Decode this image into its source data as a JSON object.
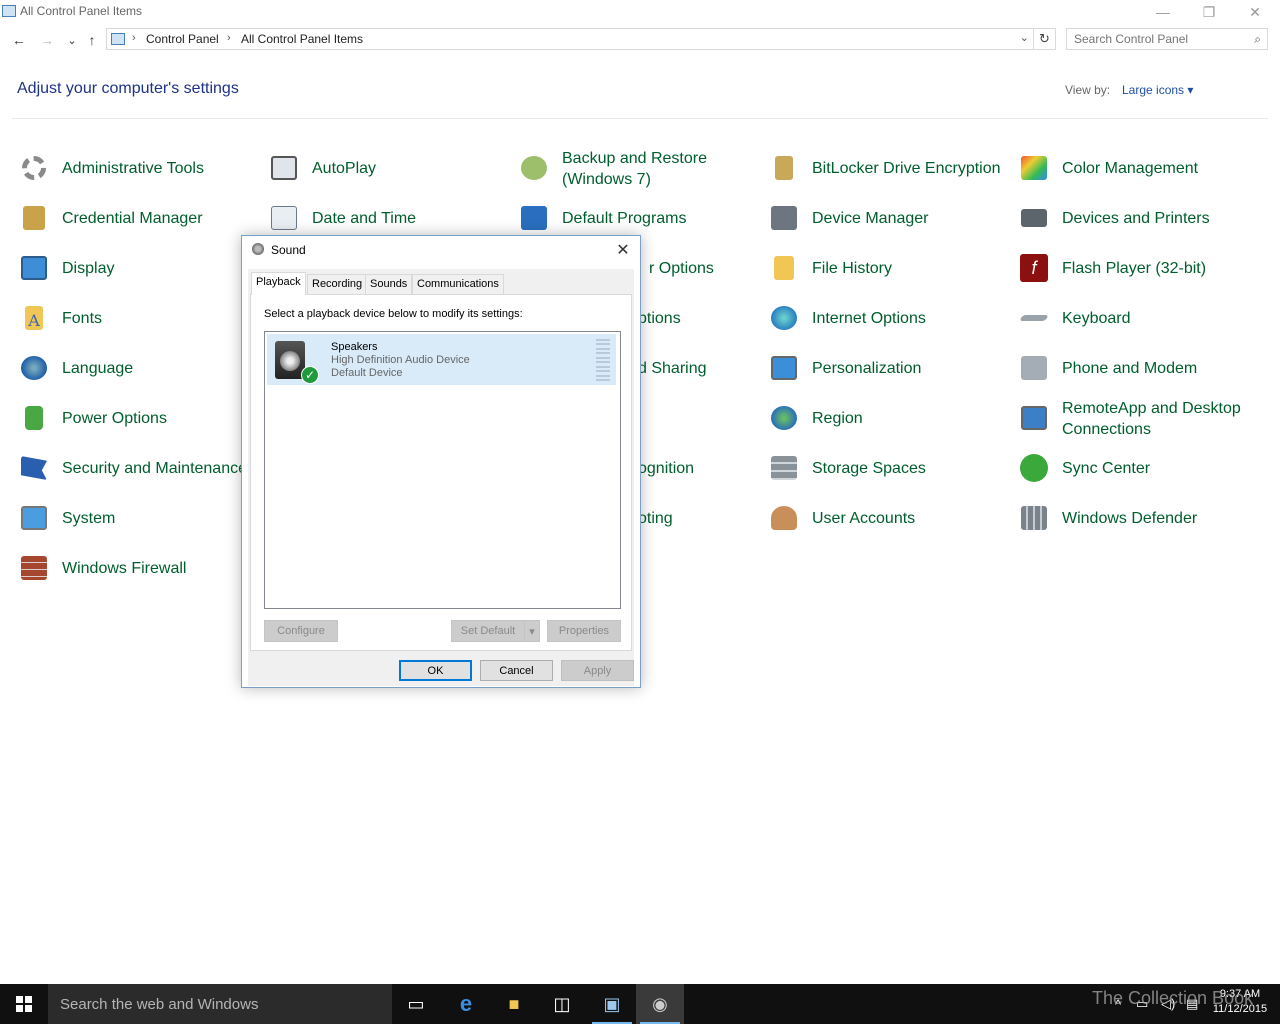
{
  "window": {
    "title": "All Control Panel Items",
    "minimize_glyph": "—",
    "restore_glyph": "❐",
    "close_glyph": "✕"
  },
  "nav": {
    "back_glyph": "←",
    "forward_glyph": "→",
    "recent_glyph": "⌄",
    "up_glyph": "↑"
  },
  "breadcrumb": [
    "Control Panel",
    "All Control Panel Items"
  ],
  "search": {
    "placeholder": "Search Control Panel"
  },
  "header": {
    "title": "Adjust your computer's settings",
    "view_by_label": "View by:",
    "view_by_value": "Large icons"
  },
  "items": [
    {
      "label": "Administrative Tools",
      "icon": "admin-tools-icon"
    },
    {
      "label": "AutoPlay",
      "icon": "autoplay-icon"
    },
    {
      "label": "Backup and Restore (Windows 7)",
      "icon": "backup-restore-icon"
    },
    {
      "label": "BitLocker Drive Encryption",
      "icon": "bitlocker-icon"
    },
    {
      "label": "Color Management",
      "icon": "color-management-icon"
    },
    {
      "label": "Credential Manager",
      "icon": "credential-manager-icon"
    },
    {
      "label": "Date and Time",
      "icon": "date-time-icon"
    },
    {
      "label": "Default Programs",
      "icon": "default-programs-icon"
    },
    {
      "label": "Device Manager",
      "icon": "device-manager-icon"
    },
    {
      "label": "Devices and Printers",
      "icon": "devices-printers-icon"
    },
    {
      "label": "Display",
      "icon": "display-icon"
    },
    {
      "label": "r Options",
      "icon": ""
    },
    {
      "label": "File History",
      "icon": "file-history-icon"
    },
    {
      "label": "Flash Player (32-bit)",
      "icon": "flash-player-icon"
    },
    {
      "label": "Fonts",
      "icon": "fonts-icon"
    },
    {
      "label": "ptions",
      "icon": ""
    },
    {
      "label": "Internet Options",
      "icon": "internet-options-icon"
    },
    {
      "label": "Keyboard",
      "icon": "keyboard-icon"
    },
    {
      "label": "Language",
      "icon": "language-icon"
    },
    {
      "label": "d Sharing",
      "icon": ""
    },
    {
      "label": "Personalization",
      "icon": "personalization-icon"
    },
    {
      "label": "Phone and Modem",
      "icon": "phone-modem-icon"
    },
    {
      "label": "Power Options",
      "icon": "power-options-icon"
    },
    {
      "label": "Region",
      "icon": "region-icon"
    },
    {
      "label": "RemoteApp and Desktop Connections",
      "icon": "remoteapp-icon"
    },
    {
      "label": "Security and Maintenance",
      "icon": "security-maintenance-icon"
    },
    {
      "label": "ognition",
      "icon": ""
    },
    {
      "label": "Storage Spaces",
      "icon": "storage-spaces-icon"
    },
    {
      "label": "Sync Center",
      "icon": "sync-center-icon"
    },
    {
      "label": "System",
      "icon": "system-icon"
    },
    {
      "label": "oting",
      "icon": ""
    },
    {
      "label": "User Accounts",
      "icon": "user-accounts-icon"
    },
    {
      "label": "Windows Defender",
      "icon": "windows-defender-icon"
    },
    {
      "label": "Windows Firewall",
      "icon": "windows-firewall-icon"
    }
  ],
  "dialog": {
    "title": "Sound",
    "close_glyph": "✕",
    "tabs": [
      "Playback",
      "Recording",
      "Sounds",
      "Communications"
    ],
    "active_tab": "Playback",
    "instruction": "Select a playback device below to modify its settings:",
    "device": {
      "name": "Speakers",
      "description": "High Definition Audio Device",
      "status": "Default Device"
    },
    "buttons": {
      "configure": "Configure",
      "set_default": "Set Default",
      "properties": "Properties",
      "ok": "OK",
      "cancel": "Cancel",
      "apply": "Apply"
    }
  },
  "taskbar": {
    "search_placeholder": "Search the web and Windows",
    "time": "9:37 AM",
    "date": "11/12/2015",
    "watermark": "The Collection Book"
  },
  "colors": {
    "link_green": "#005e2c",
    "heading_blue": "#1e3287",
    "taskbar": "#101010",
    "accent": "#0078d7"
  }
}
